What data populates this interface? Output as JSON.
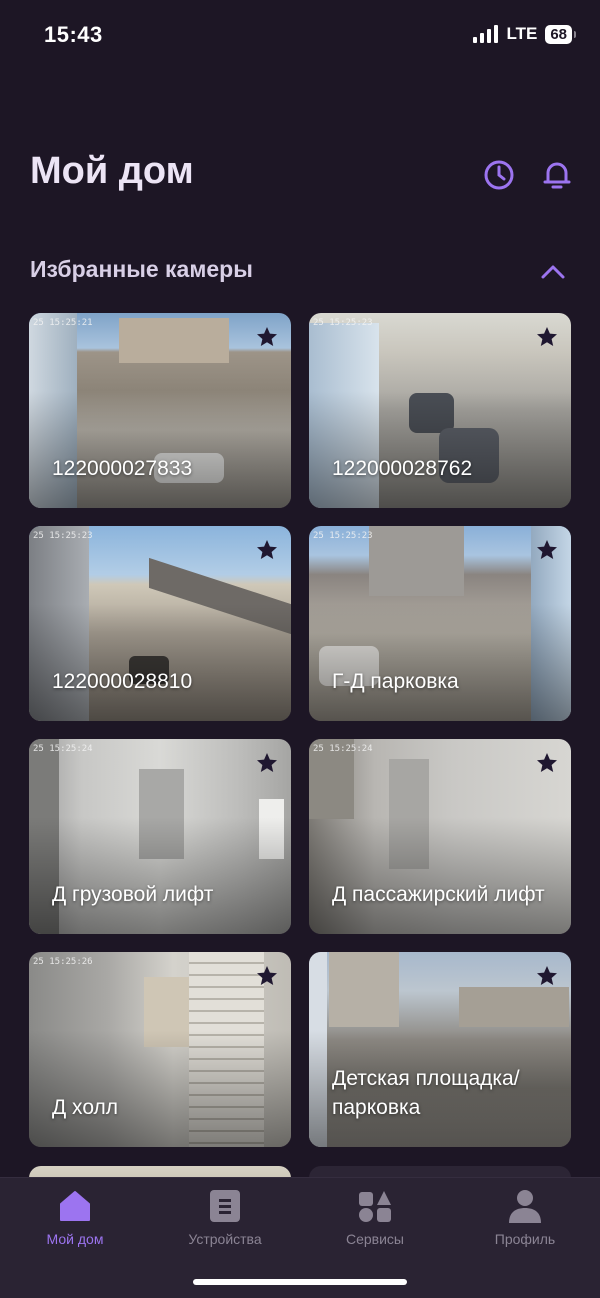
{
  "status": {
    "time": "15:43",
    "network": "LTE",
    "battery": "68"
  },
  "header": {
    "title": "Мой дом",
    "icons": [
      "history-icon",
      "bell-icon"
    ]
  },
  "favorites": {
    "title": "Избранные камеры",
    "cameras": [
      {
        "label": "122000027833",
        "timestamp": "25 15:25:21",
        "favorite": true
      },
      {
        "label": "122000028762",
        "timestamp": "25 15:25:23",
        "favorite": true
      },
      {
        "label": "122000028810",
        "timestamp": "25 15:25:23",
        "favorite": true
      },
      {
        "label": "Г-Д парковка",
        "timestamp": "25 15:25:23",
        "favorite": true
      },
      {
        "label": "Д грузовой лифт",
        "timestamp": "25 15:25:24",
        "favorite": true
      },
      {
        "label": "Д пассажирский лифт",
        "timestamp": "25 15:25:24",
        "favorite": true
      },
      {
        "label": "Д холл",
        "timestamp": "25 15:25:26",
        "favorite": true
      },
      {
        "label": "Детская площадка/ парковка",
        "timestamp": "",
        "favorite": true
      }
    ]
  },
  "nav": {
    "items": [
      {
        "label": "Мой дом",
        "icon": "home-icon",
        "active": true
      },
      {
        "label": "Устройства",
        "icon": "devices-icon",
        "active": false
      },
      {
        "label": "Сервисы",
        "icon": "services-icon",
        "active": false
      },
      {
        "label": "Профиль",
        "icon": "profile-icon",
        "active": false
      }
    ]
  },
  "colors": {
    "background": "#1d1625",
    "accent": "#9c74f0",
    "nav_background": "#2a2333",
    "inactive_icon": "#8b8494"
  }
}
